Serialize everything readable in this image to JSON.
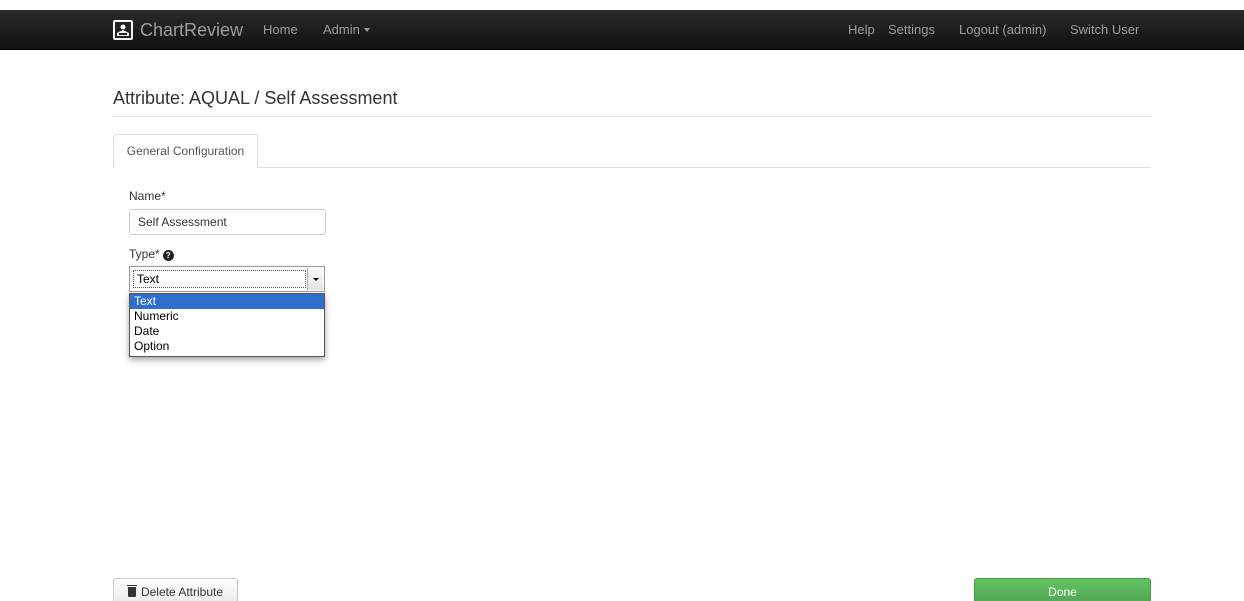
{
  "navbar": {
    "brand": "ChartReview",
    "home": "Home",
    "admin": "Admin",
    "help": "Help",
    "settings": "Settings",
    "logout": "Logout (admin)",
    "switch_user": "Switch User"
  },
  "page": {
    "title": "Attribute: AQUAL / Self Assessment"
  },
  "tabs": [
    {
      "label": "General Configuration"
    }
  ],
  "form": {
    "name_label": "Name*",
    "name_value": "Self Assessment",
    "type_label": "Type*",
    "type_selected": "Text",
    "type_options": [
      "Text",
      "Numeric",
      "Date",
      "Option"
    ],
    "help_icon": "question-circle-icon"
  },
  "buttons": {
    "delete": "Delete Attribute",
    "done": "Done"
  },
  "colors": {
    "navbar": "#1b1b1b",
    "selected_option": "#2f6fce",
    "done_button": "#5bb75b"
  }
}
